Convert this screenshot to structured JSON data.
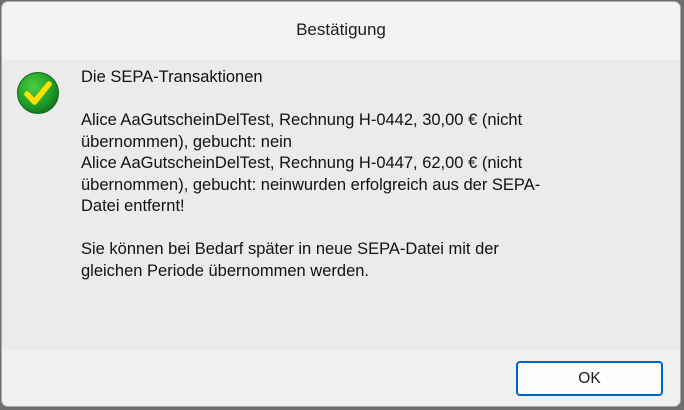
{
  "window": {
    "title": "Bestätigung"
  },
  "icon": {
    "name": "success-check-icon",
    "colors": {
      "circle": "#1f9d2b",
      "check": "#ffe100"
    }
  },
  "message": {
    "line1": "Die SEPA-Transaktionen",
    "line2": "Alice AaGutscheinDelTest, Rechnung H-0442, 30,00 € (nicht",
    "line3": "übernommen), gebucht: nein",
    "line4": "Alice AaGutscheinDelTest, Rechnung H-0447, 62,00 € (nicht",
    "line5": "übernommen), gebucht: neinwurden erfolgreich aus der SEPA-",
    "line6": "Datei entfernt!",
    "line7": "Sie können bei Bedarf später in neue SEPA-Datei mit der",
    "line8": "gleichen Periode übernommen werden."
  },
  "buttons": {
    "ok_label": "OK"
  }
}
